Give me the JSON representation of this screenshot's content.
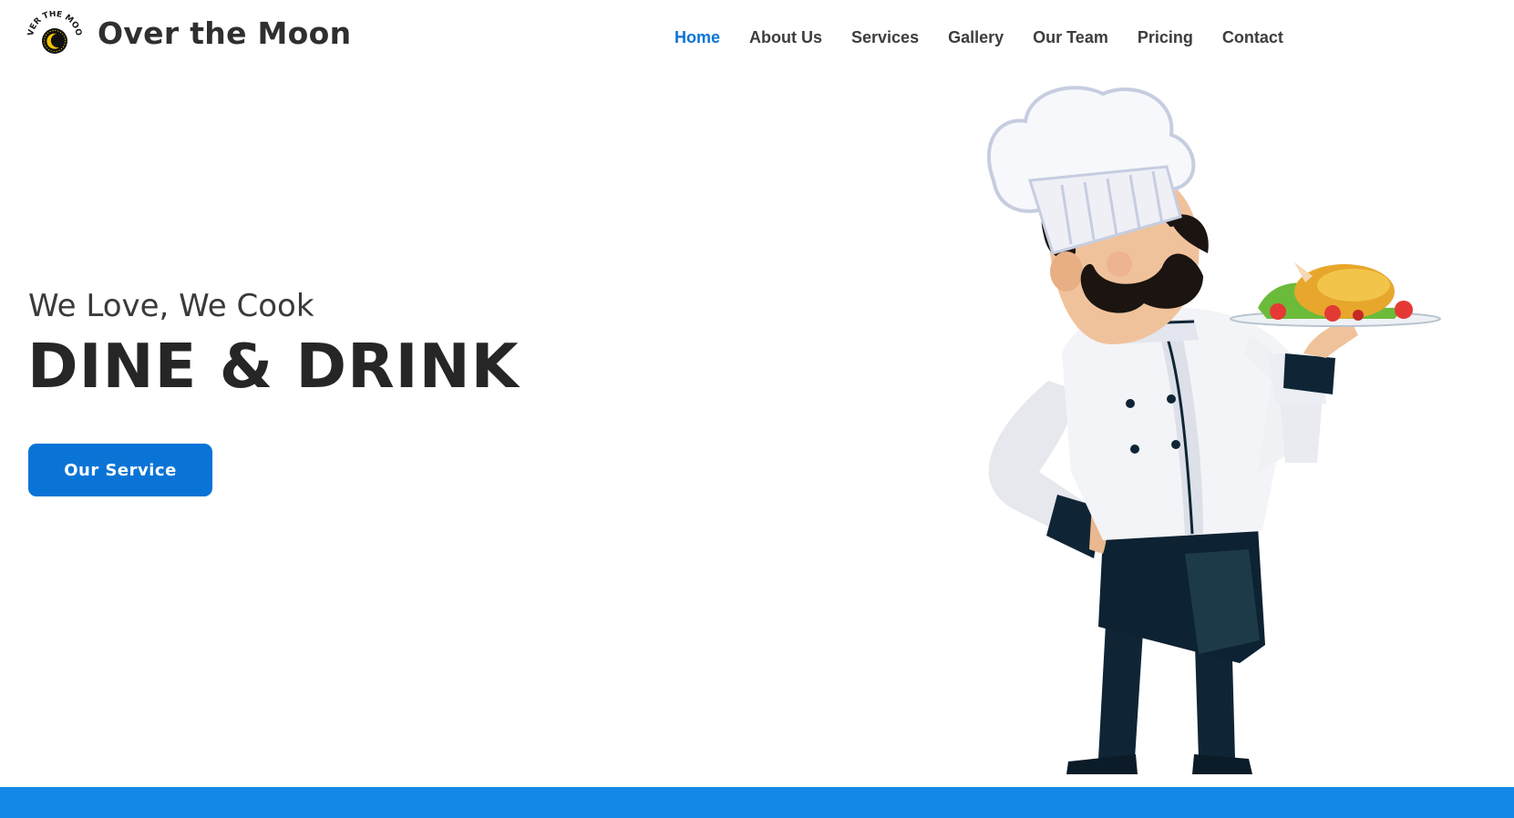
{
  "header": {
    "logo_text": "OVER THE MOON",
    "brand_name": "Over the Moon"
  },
  "nav": {
    "items": [
      {
        "label": "Home",
        "active": true
      },
      {
        "label": "About Us",
        "active": false
      },
      {
        "label": "Services",
        "active": false
      },
      {
        "label": "Gallery",
        "active": false
      },
      {
        "label": "Our Team",
        "active": false
      },
      {
        "label": "Pricing",
        "active": false
      },
      {
        "label": "Contact",
        "active": false
      }
    ]
  },
  "hero": {
    "subtitle": "We Love, We Cook",
    "title": "DINE & DRINK",
    "cta_label": "Our Service"
  },
  "colors": {
    "accent": "#0a74d6",
    "bottom_bar": "#1388e6",
    "text_dark": "#2d2d2d"
  },
  "icons": {
    "logo": "moon-logo-icon",
    "illustration": "chef-illustration"
  }
}
